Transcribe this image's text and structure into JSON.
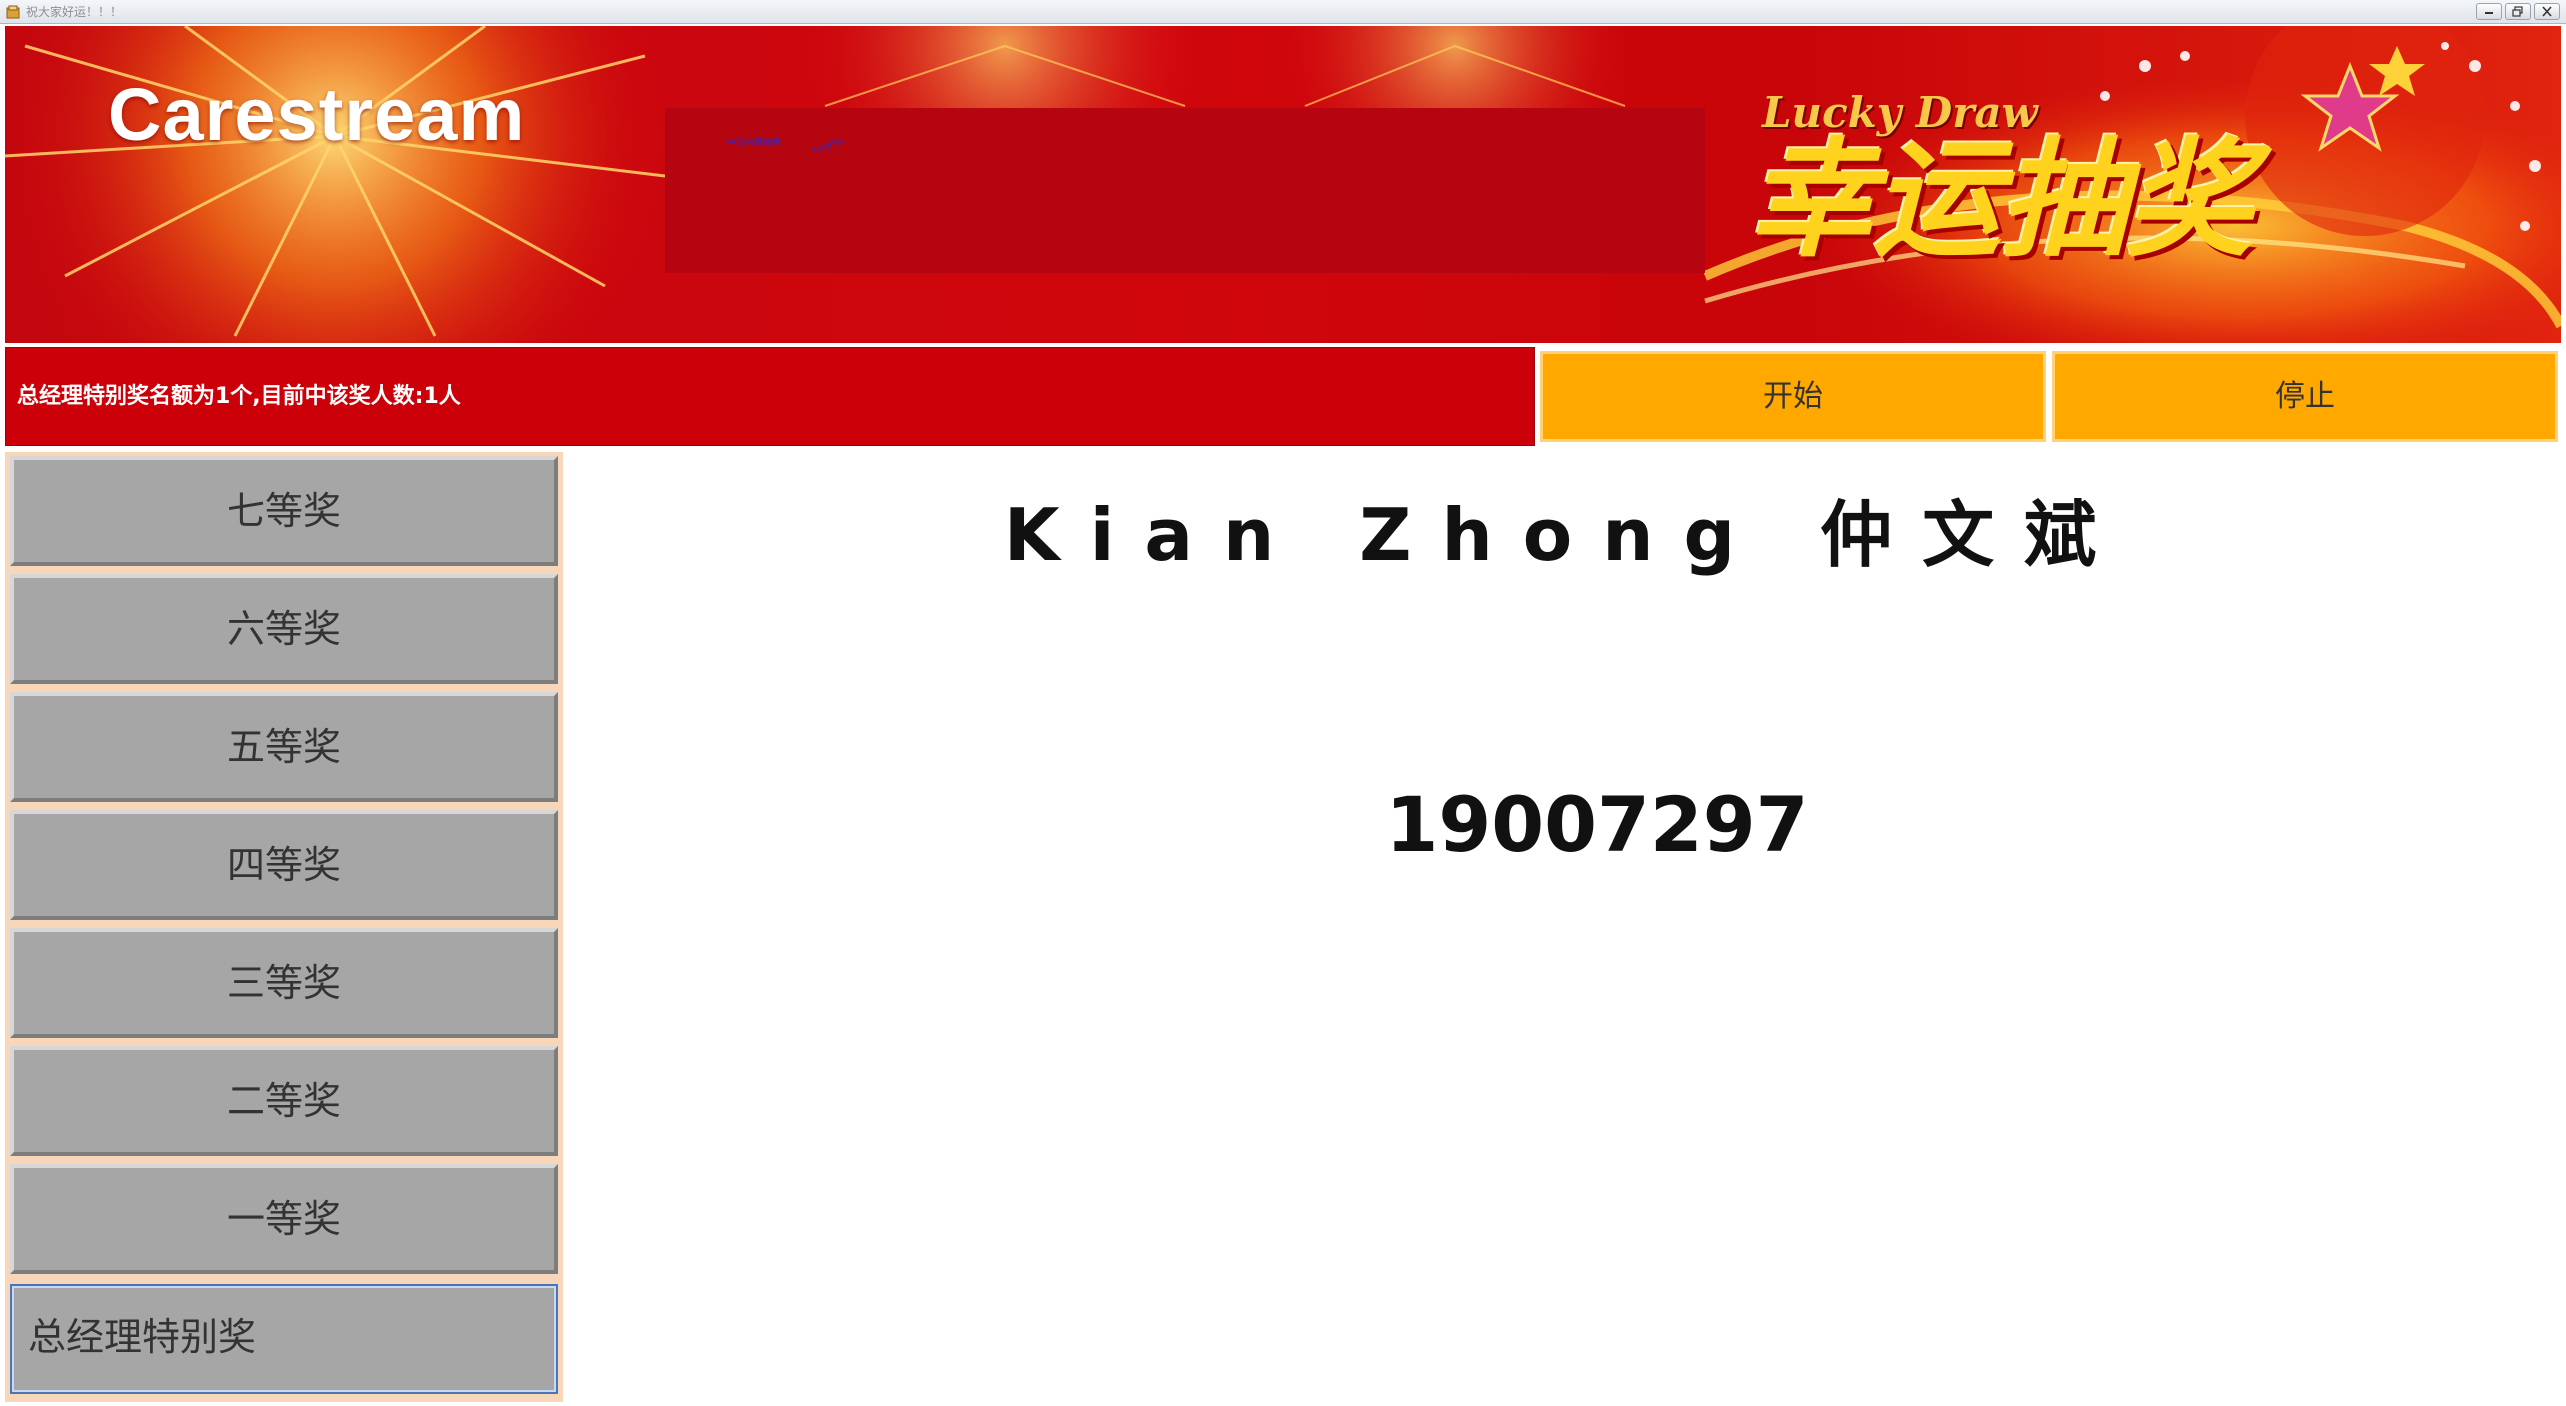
{
  "window": {
    "title": "祝大家好运！！！",
    "controls": [
      "minimize",
      "restore",
      "close"
    ]
  },
  "banner": {
    "brand": "Carestream",
    "small_text_1": "中文内容显示",
    "small_text_2": "english",
    "subtitle": "Lucky Draw",
    "title": "幸运抽奖"
  },
  "status": {
    "text": "总经理特别奖名额为1个,目前中该奖人数:1人"
  },
  "controls": {
    "start_label": "开始",
    "stop_label": "停止"
  },
  "prizes": [
    {
      "label": "七等奖",
      "selected": false
    },
    {
      "label": "六等奖",
      "selected": false
    },
    {
      "label": "五等奖",
      "selected": false
    },
    {
      "label": "四等奖",
      "selected": false
    },
    {
      "label": "三等奖",
      "selected": false
    },
    {
      "label": "二等奖",
      "selected": false
    },
    {
      "label": "一等奖",
      "selected": false
    },
    {
      "label": "总经理特别奖",
      "selected": true
    }
  ],
  "winner": {
    "name": "Kian Zhong 仲文斌",
    "id": "19007297"
  },
  "colors": {
    "banner_red": "#cc0009",
    "button_orange": "#ffa800",
    "prize_gray": "#a6a6a6",
    "sidebar_bg": "#f7d6ba",
    "title_gold": "#ffd21e"
  }
}
